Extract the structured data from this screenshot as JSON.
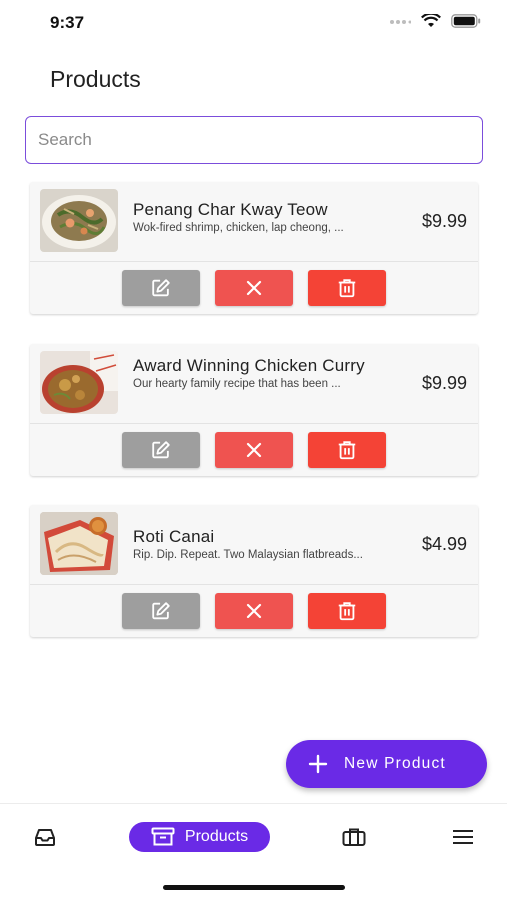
{
  "status_bar": {
    "time": "9:37"
  },
  "header": {
    "title": "Products"
  },
  "search": {
    "placeholder": "Search"
  },
  "products": [
    {
      "name": "Penang Char Kway Teow",
      "description": "Wok-fired shrimp, chicken, lap cheong, ...",
      "price": "$9.99"
    },
    {
      "name": "Award Winning Chicken Curry",
      "description": "Our hearty family recipe that has been ...",
      "price": "$9.99"
    },
    {
      "name": "Roti Canai",
      "description": "Rip. Dip. Repeat. Two Malaysian flatbreads...",
      "price": "$4.99"
    }
  ],
  "actions": {
    "edit_icon": "edit-icon",
    "cancel_icon": "close-icon",
    "delete_icon": "trash-icon"
  },
  "fab": {
    "label": "New Product",
    "icon": "plus-icon"
  },
  "bottom_nav": {
    "items": [
      {
        "icon": "inbox-icon",
        "label": ""
      },
      {
        "icon": "archive-icon",
        "label": "Products",
        "active": true
      },
      {
        "icon": "briefcase-icon",
        "label": ""
      },
      {
        "icon": "menu-icon",
        "label": ""
      }
    ]
  },
  "colors": {
    "accent": "#6a2ae6",
    "search_border": "#7b4ddb",
    "edit": "#9e9e9e",
    "cancel": "#ef5350",
    "delete": "#f44336"
  }
}
